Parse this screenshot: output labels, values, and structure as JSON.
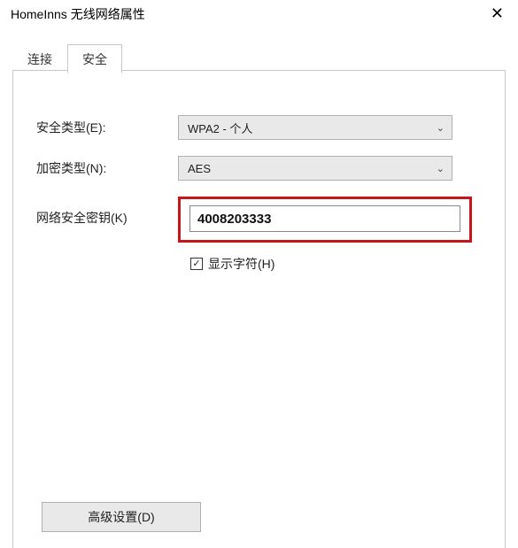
{
  "window": {
    "title": "HomeInns 无线网络属性"
  },
  "tabs": {
    "connection": "连接",
    "security": "安全"
  },
  "form": {
    "security_type_label": "安全类型(E):",
    "security_type_value": "WPA2 - 个人",
    "encryption_type_label": "加密类型(N):",
    "encryption_type_value": "AES",
    "network_key_label": "网络安全密钥(K)",
    "network_key_value": "4008203333",
    "show_chars_label": "显示字符(H)",
    "show_chars_checked": true
  },
  "buttons": {
    "advanced": "高级设置(D)"
  },
  "icons": {
    "close": "✕",
    "chevron_down": "⌄",
    "check": "✓"
  }
}
